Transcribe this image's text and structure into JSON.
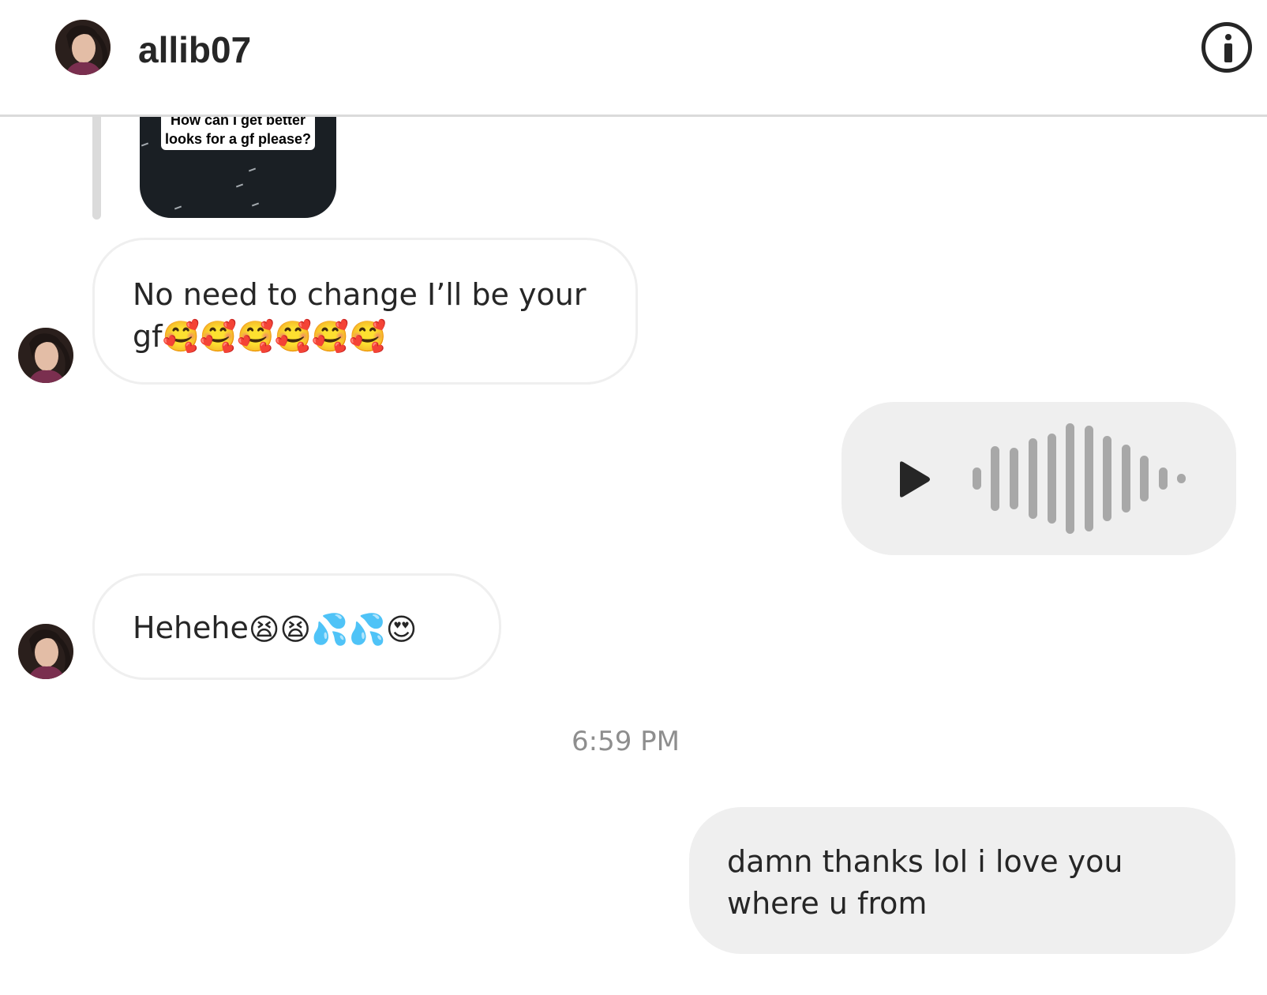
{
  "header": {
    "username": "allib07",
    "info_icon": "info-circle-icon",
    "avatar_icon": "profile-avatar"
  },
  "reply_preview": {
    "story_caption": "How can I get better looks for a gf please?"
  },
  "messages": [
    {
      "sender": "allib07",
      "direction": "incoming",
      "text": "No need to change I’ll be your gf🥰🥰🥰🥰🥰🥰"
    },
    {
      "sender": "me",
      "direction": "outgoing",
      "type": "voice",
      "play_icon": "play-icon"
    },
    {
      "sender": "allib07",
      "direction": "incoming",
      "text": "Hehehe",
      "emojis": [
        "😫",
        "😫",
        "💦",
        "💦",
        "😍"
      ]
    },
    {
      "type": "timestamp",
      "text": "6:59 PM"
    },
    {
      "sender": "me",
      "direction": "outgoing",
      "text": "damn thanks lol i love you where u from"
    }
  ],
  "colors": {
    "outgoing_bubble": "#efefef",
    "incoming_border": "#efefef",
    "text": "#262626",
    "timestamp": "#8e8e8e",
    "waveform": "#a8a8a8"
  }
}
